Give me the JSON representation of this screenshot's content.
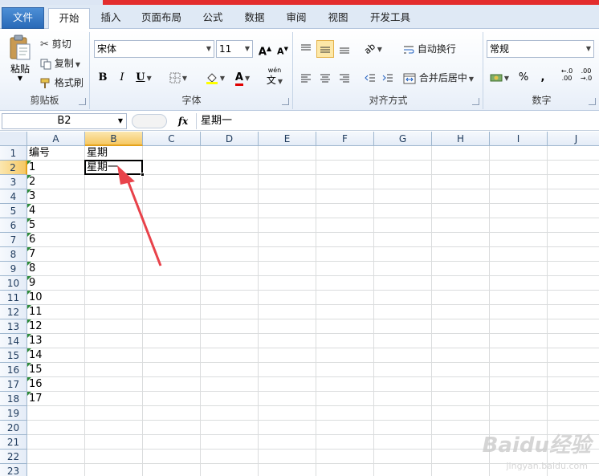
{
  "tabs": [
    {
      "label": "文件",
      "key": "file"
    },
    {
      "label": "开始",
      "key": "home"
    },
    {
      "label": "插入",
      "key": "insert"
    },
    {
      "label": "页面布局",
      "key": "layout"
    },
    {
      "label": "公式",
      "key": "formulas"
    },
    {
      "label": "数据",
      "key": "data"
    },
    {
      "label": "审阅",
      "key": "review"
    },
    {
      "label": "视图",
      "key": "view"
    },
    {
      "label": "开发工具",
      "key": "developer"
    }
  ],
  "clipboard": {
    "paste_label": "粘贴",
    "cut_label": "剪切",
    "copy_label": "复制",
    "format_painter_label": "格式刷",
    "group_label": "剪贴板"
  },
  "font": {
    "font_name": "宋体",
    "font_size": "11",
    "group_label": "字体",
    "bold": "B",
    "italic": "I",
    "underline": "U",
    "grow": "A",
    "shrink": "A",
    "phonetic": "wén",
    "phonetic_char": "文",
    "font_color_glyph": "A"
  },
  "alignment": {
    "wrap_label": "自动换行",
    "merge_label": "合并后居中",
    "group_label": "对齐方式"
  },
  "number": {
    "format_value": "常规",
    "percent": "%",
    "comma": ",",
    "inc_decimal": "←.0\n.00",
    "dec_decimal": ".00\n→.0",
    "group_label": "数字"
  },
  "formula_bar": {
    "name_box": "B2",
    "fx": "fx",
    "content": "星期一"
  },
  "columns": [
    "A",
    "B",
    "C",
    "D",
    "E",
    "F",
    "G",
    "H",
    "I",
    "J"
  ],
  "rows": [
    "1",
    "2",
    "3",
    "4",
    "5",
    "6",
    "7",
    "8",
    "9",
    "10",
    "11",
    "12",
    "13",
    "14",
    "15",
    "16",
    "17",
    "18",
    "19",
    "20",
    "21",
    "22",
    "23"
  ],
  "cells": {
    "A": [
      "编号",
      "1",
      "2",
      "3",
      "4",
      "5",
      "6",
      "7",
      "8",
      "9",
      "10",
      "11",
      "12",
      "13",
      "14",
      "15",
      "16",
      "17"
    ],
    "B": [
      "星期",
      "星期一"
    ]
  },
  "selected_cell": "B2",
  "watermark": {
    "brand": "Baidu经验",
    "url": "jingyan.baidu.com"
  },
  "colors": {
    "file_tab": "#2a6ab8",
    "accent_selected": "#f6c863",
    "error_triangle": "#2e8b3a",
    "arrow": "#e8424a"
  }
}
